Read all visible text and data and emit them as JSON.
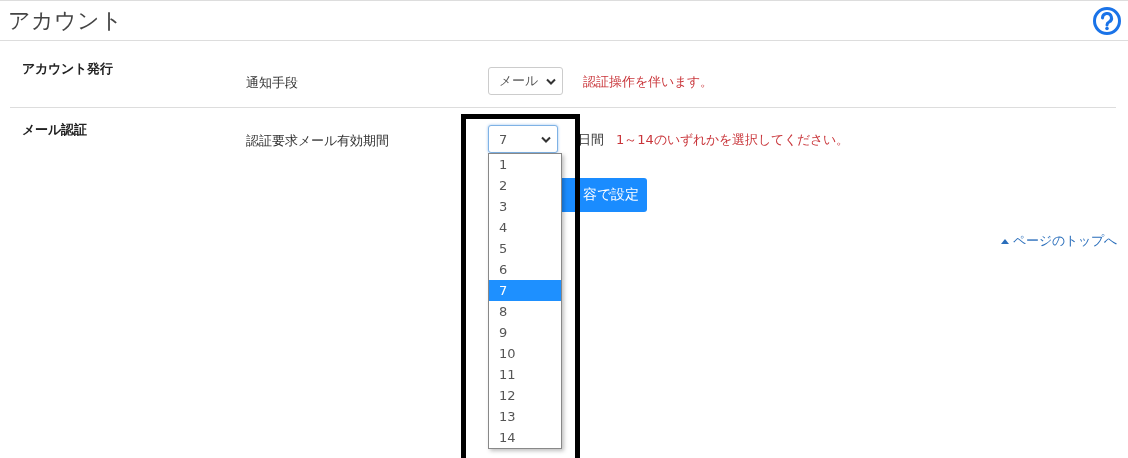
{
  "header": {
    "title": "アカウント"
  },
  "sections": [
    {
      "label": "アカウント発行",
      "field_label": "通知手段",
      "select": {
        "value": "メール",
        "focused": false
      },
      "note": "認証操作を伴います。"
    },
    {
      "label": "メール認証",
      "field_label": "認証要求メール有効期間",
      "select": {
        "value": "7",
        "focused": true,
        "expanded": true,
        "suffix": "日間",
        "options": [
          {
            "label": "1",
            "selected": false
          },
          {
            "label": "2",
            "selected": false
          },
          {
            "label": "3",
            "selected": false
          },
          {
            "label": "4",
            "selected": false
          },
          {
            "label": "5",
            "selected": false
          },
          {
            "label": "6",
            "selected": false
          },
          {
            "label": "7",
            "selected": true
          },
          {
            "label": "8",
            "selected": false
          },
          {
            "label": "9",
            "selected": false
          },
          {
            "label": "10",
            "selected": false
          },
          {
            "label": "11",
            "selected": false
          },
          {
            "label": "12",
            "selected": false
          },
          {
            "label": "13",
            "selected": false
          },
          {
            "label": "14",
            "selected": false
          }
        ]
      },
      "note": "1～14のいずれかを選択してください。"
    }
  ],
  "submit_button": "容で設定",
  "page_top_link": "ページのトップへ"
}
